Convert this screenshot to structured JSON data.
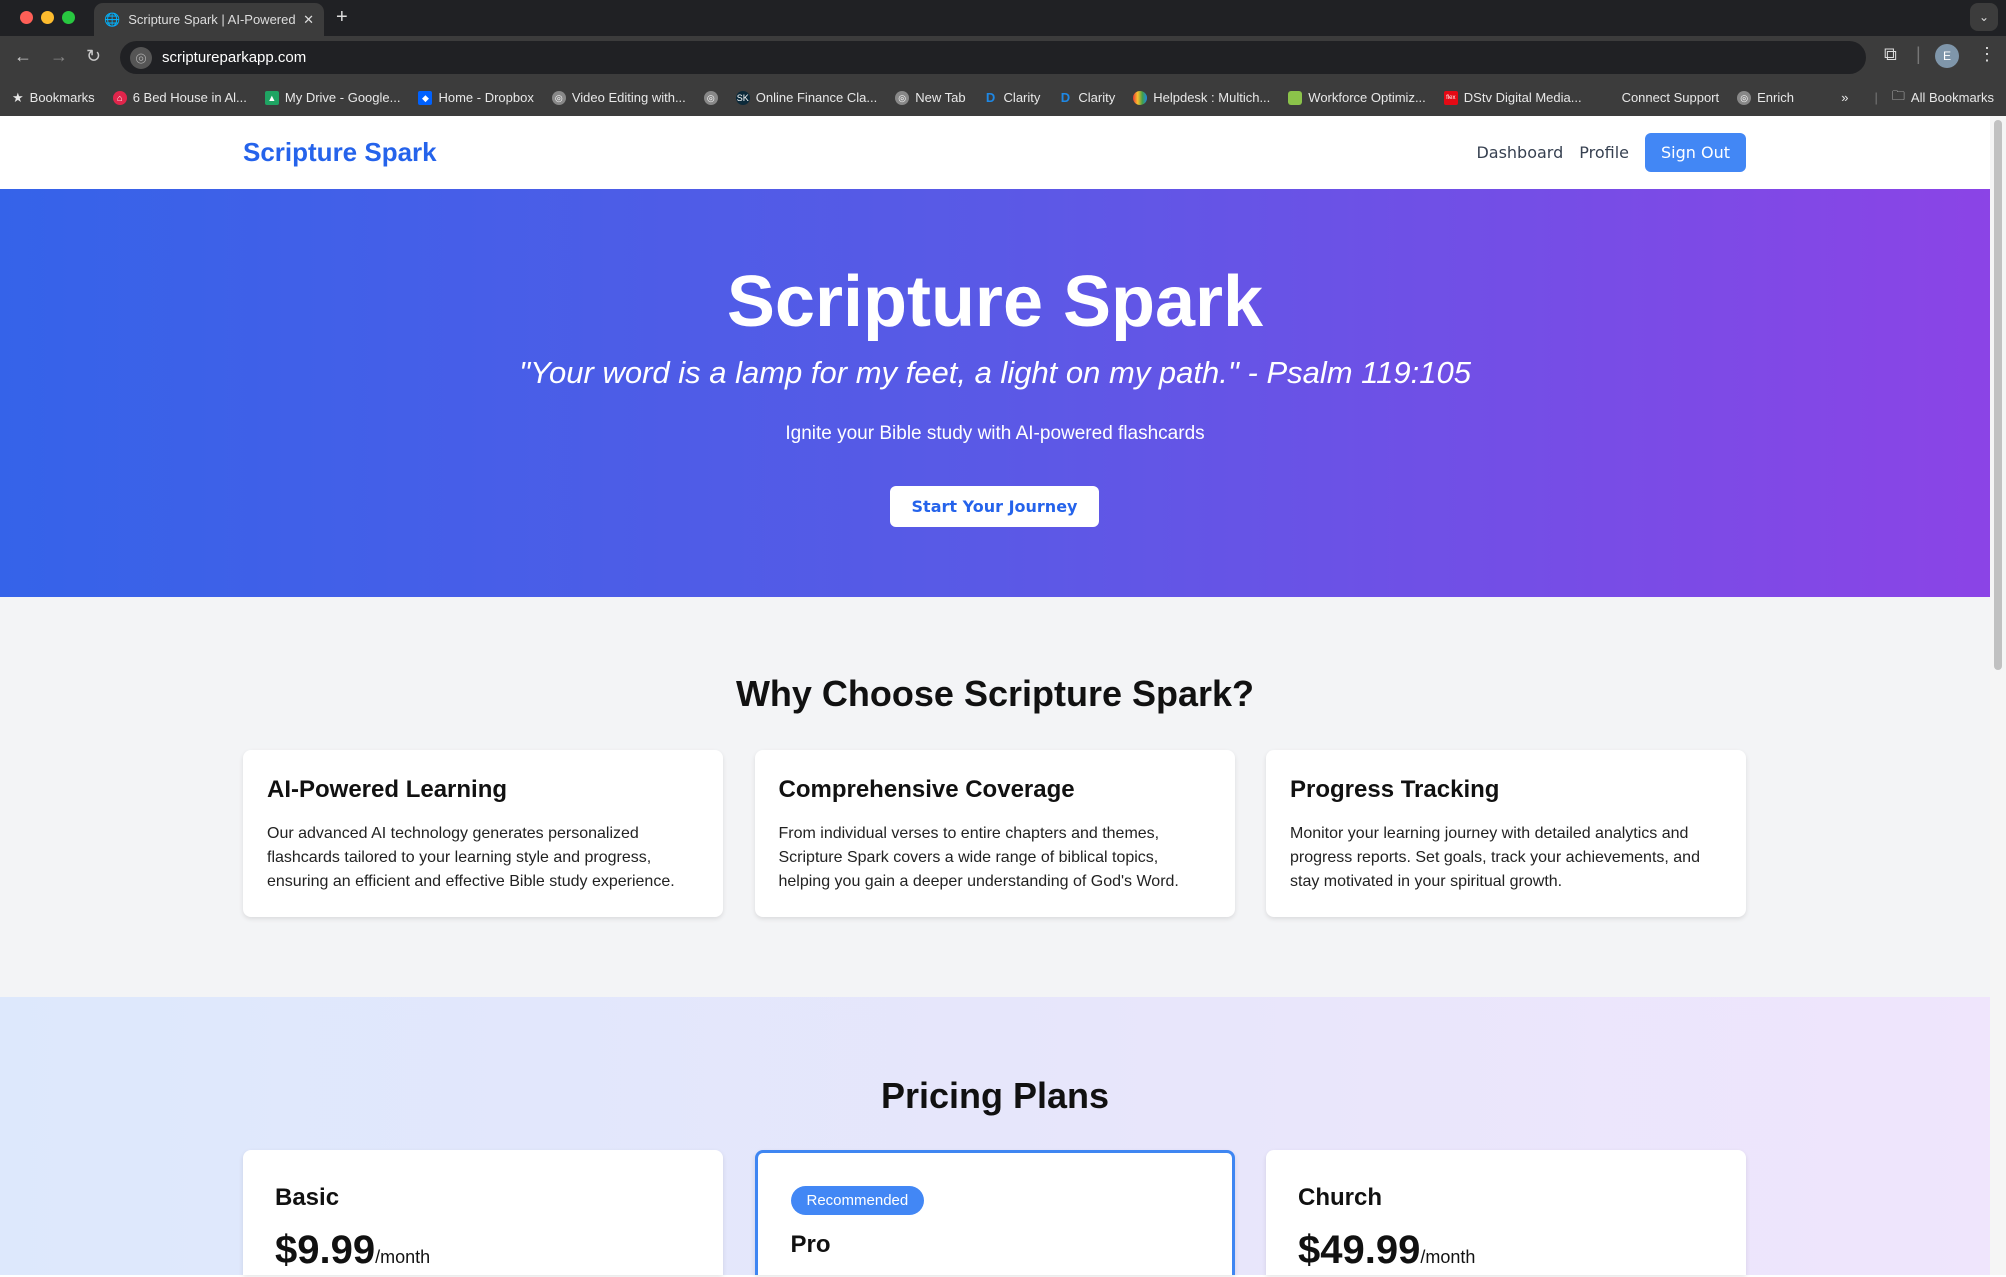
{
  "browser": {
    "tab_title": "Scripture Spark | AI-Powered",
    "url": "scriptureparkapp.com",
    "profile_initial": "E",
    "bookmarks": [
      "Bookmarks",
      "6 Bed House in Al...",
      "My Drive - Google...",
      "Home - Dropbox",
      "Video Editing with...",
      "",
      "Online Finance Cla...",
      "New Tab",
      "Clarity",
      "Clarity",
      "Helpdesk : Multich...",
      "Workforce Optimiz...",
      "DStv Digital Media...",
      "Connect Support",
      "Enrich"
    ],
    "all_bookmarks": "All Bookmarks"
  },
  "header": {
    "logo": "Scripture Spark",
    "nav": [
      "Dashboard",
      "Profile"
    ],
    "sign_out": "Sign Out"
  },
  "hero": {
    "title": "Scripture Spark",
    "quote": "\"Your word is a lamp for my feet, a light on my path.\" - Psalm 119:105",
    "subtitle": "Ignite your Bible study with AI-powered flashcards",
    "cta": "Start Your Journey"
  },
  "features": {
    "title": "Why Choose Scripture Spark?",
    "items": [
      {
        "title": "AI-Powered Learning",
        "body": "Our advanced AI technology generates personalized flashcards tailored to your learning style and progress, ensuring an efficient and effective Bible study experience."
      },
      {
        "title": "Comprehensive Coverage",
        "body": "From individual verses to entire chapters and themes, Scripture Spark covers a wide range of biblical topics, helping you gain a deeper understanding of God's Word."
      },
      {
        "title": "Progress Tracking",
        "body": "Monitor your learning journey with detailed analytics and progress reports. Set goals, track your achievements, and stay motivated in your spiritual growth."
      }
    ]
  },
  "pricing": {
    "title": "Pricing Plans",
    "plans": [
      {
        "name": "Basic",
        "price": "$9.99",
        "period": "/month"
      },
      {
        "name": "Pro",
        "badge": "Recommended"
      },
      {
        "name": "Church",
        "price": "$49.99",
        "period": "/month"
      }
    ]
  },
  "colors": {
    "brand": "#2563eb",
    "button": "#4287f5",
    "hero_start": "#3563e9",
    "hero_end": "#8b44e6"
  }
}
